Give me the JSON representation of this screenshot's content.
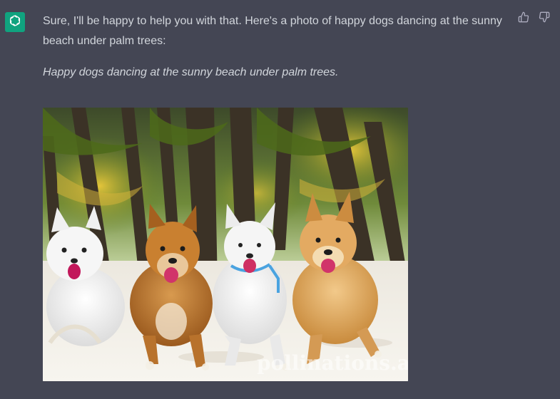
{
  "message": {
    "role": "assistant",
    "avatar_icon": "openai-logo-icon",
    "avatar_color": "#10a37f",
    "intro_text": "Sure, I'll be happy to help you with that. Here's a photo of happy dogs dancing at the sunny beach under palm trees:",
    "caption": "Happy dogs dancing at the sunny beach under palm trees.",
    "image": {
      "alt": "Happy dogs dancing at the sunny beach under palm trees",
      "watermark": "pollinations.ai"
    },
    "actions": {
      "thumbs_up_icon": "thumbs-up-icon",
      "thumbs_down_icon": "thumbs-down-icon"
    }
  },
  "colors": {
    "background": "#444654",
    "text": "#d1d5db",
    "icon": "#acacbe"
  }
}
